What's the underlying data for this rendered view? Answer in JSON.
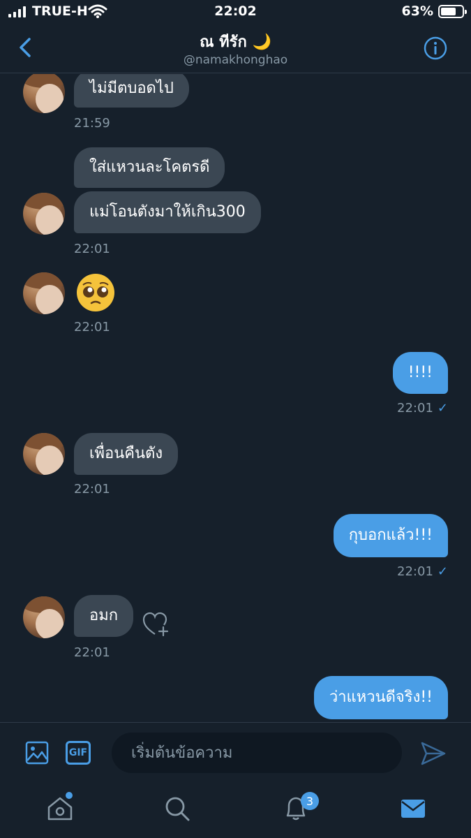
{
  "status_bar": {
    "carrier": "TRUE-H",
    "time": "22:02",
    "battery": "63%"
  },
  "header": {
    "title": "ณ ทีรัก 🌙",
    "handle": "@namakhonghao"
  },
  "messages": [
    {
      "text": "ไม่มีตบอดไป",
      "time": "21:59"
    },
    {
      "text": "ใส่แหวนละโคตรดี"
    },
    {
      "text": "แม่โอนตังมาให้เกิน300",
      "time": "22:01"
    },
    {
      "emoji": "pleading-face",
      "time": "22:01"
    },
    {
      "text": "!!!!",
      "time": "22:01",
      "read": "✓"
    },
    {
      "text": "เพื่อนคืนตัง",
      "time": "22:01"
    },
    {
      "text": "กุบอกแล้ว!!!",
      "time": "22:01",
      "read": "✓"
    },
    {
      "text": "อมก",
      "time": "22:01"
    },
    {
      "text": "ว่าแหวนดีจริง!!"
    }
  ],
  "compose": {
    "placeholder": "เริ่มต้นข้อความ",
    "gif_label": "GIF"
  },
  "tabs": {
    "notifications_badge": "3"
  },
  "colors": {
    "background": "#16202b",
    "incoming_bubble": "#3b4753",
    "outgoing_bubble": "#4a9ee6",
    "accent": "#4a9ee6",
    "muted_text": "#8899a6"
  }
}
